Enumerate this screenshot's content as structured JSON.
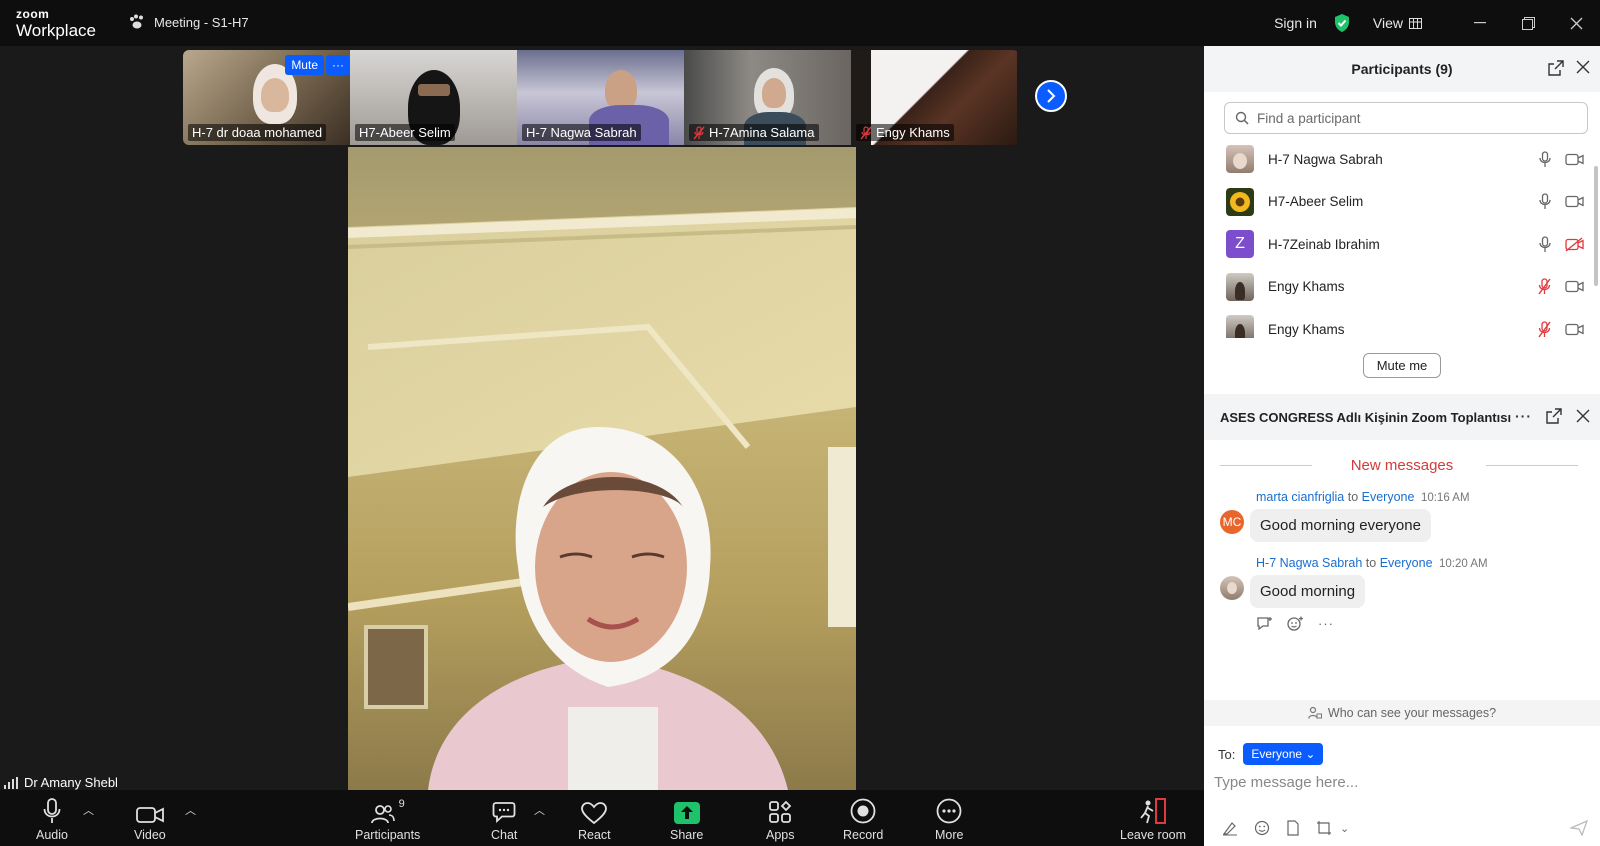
{
  "titlebar": {
    "logo_line1": "zoom",
    "logo_line2": "Workplace",
    "meeting_title": "Meeting - S1-H7",
    "sign_in": "Sign in",
    "view": "View"
  },
  "filmstrip": {
    "tiles": [
      {
        "name": "H-7 dr doaa mohamed",
        "muted": false
      },
      {
        "name": "H7-Abeer Selim",
        "muted": false
      },
      {
        "name": "H-7 Nagwa Sabrah",
        "muted": false
      },
      {
        "name": "H-7Amina Salama",
        "muted": true
      },
      {
        "name": "Engy Khams",
        "muted": true
      }
    ],
    "mute_overlay": "Mute",
    "more_overlay": "···"
  },
  "main_video": {
    "speaker_name": "Dr Amany Shebl"
  },
  "toolbar": {
    "audio": "Audio",
    "video": "Video",
    "participants": "Participants",
    "participants_count": "9",
    "chat": "Chat",
    "react": "React",
    "share": "Share",
    "apps": "Apps",
    "record": "Record",
    "more": "More",
    "leave": "Leave room"
  },
  "participants_panel": {
    "title": "Participants (9)",
    "search_placeholder": "Find a participant",
    "rows": [
      {
        "name": "H-7 Nagwa Sabrah",
        "mic_muted": false,
        "video_off": false
      },
      {
        "name": "H7-Abeer Selim",
        "mic_muted": false,
        "video_off": false
      },
      {
        "name": "H-7Zeinab Ibrahim",
        "mic_muted": false,
        "video_off": true,
        "initial": "Z"
      },
      {
        "name": "Engy Khams",
        "mic_muted": true,
        "video_off": false
      },
      {
        "name": "Engy Khams",
        "mic_muted": true,
        "video_off": false
      }
    ],
    "mute_me": "Mute me"
  },
  "chat_panel": {
    "title": "ASES CONGRESS Adlı Kişinin Zoom Toplantısı",
    "new_messages": "New messages",
    "messages": [
      {
        "sender": "marta cianfriglia",
        "to_word": "to",
        "recipient": "Everyone",
        "time": "10:16 AM",
        "text": "Good morning everyone",
        "initials": "MC"
      },
      {
        "sender": "H-7 Nagwa Sabrah",
        "to_word": "to",
        "recipient": "Everyone",
        "time": "10:20 AM",
        "text": "Good morning"
      }
    ],
    "who_can_see": "Who can see your messages?",
    "to_label": "To:",
    "to_value": "Everyone",
    "input_placeholder": "Type message here..."
  },
  "colors": {
    "accent": "#0b5cff",
    "mute_red": "#e0393e",
    "share_green": "#1ec26a",
    "new_messages_red": "#d23b3b",
    "link_blue": "#1a6ecf"
  }
}
